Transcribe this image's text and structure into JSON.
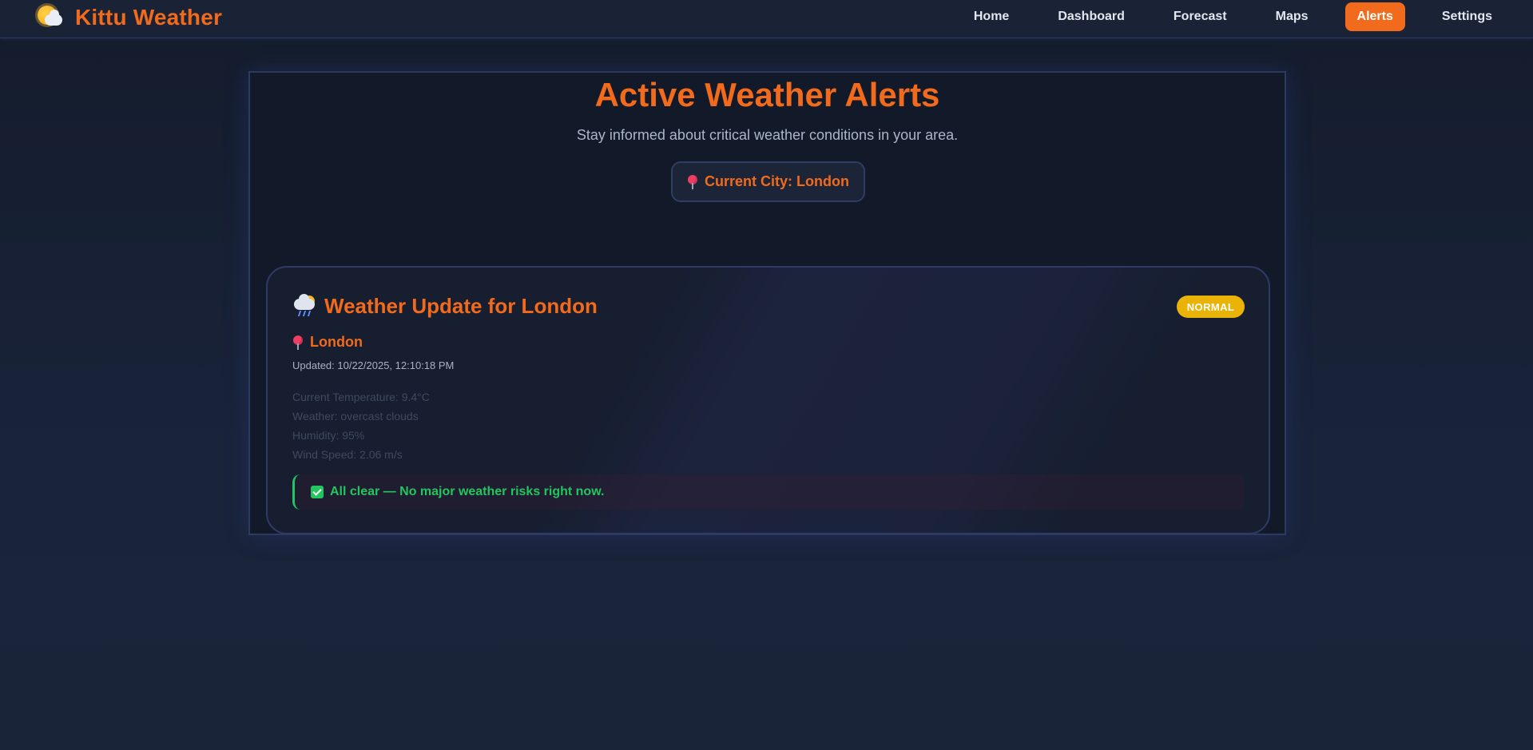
{
  "app": {
    "name": "Kittu Weather"
  },
  "nav": {
    "items": [
      {
        "label": "Home"
      },
      {
        "label": "Dashboard"
      },
      {
        "label": "Forecast"
      },
      {
        "label": "Maps"
      },
      {
        "label": "Alerts",
        "active": true
      },
      {
        "label": "Settings"
      }
    ]
  },
  "page": {
    "title": "Active Weather Alerts",
    "subtitle": "Stay informed about critical weather conditions in your area.",
    "current_city_label": "Current City: London"
  },
  "alert": {
    "title": "Weather Update for London",
    "badge": "NORMAL",
    "city": "London",
    "updated": "Updated: 10/22/2025, 12:10:18 PM",
    "stats": [
      "Current Temperature: 9.4°C",
      "Weather: overcast clouds",
      "Humidity: 95%",
      "Wind Speed: 2.06 m/s"
    ],
    "status": "All clear — No major weather risks right now."
  },
  "colors": {
    "accent": "#f26a1b",
    "badge_normal": "#eab308",
    "status_ok": "#22c55e",
    "background": "#172033"
  },
  "icons": {
    "brand": "sun-behind-cloud-icon",
    "pin": "pin-icon",
    "alert": "cloud-with-rain-icon",
    "status": "check-icon"
  }
}
